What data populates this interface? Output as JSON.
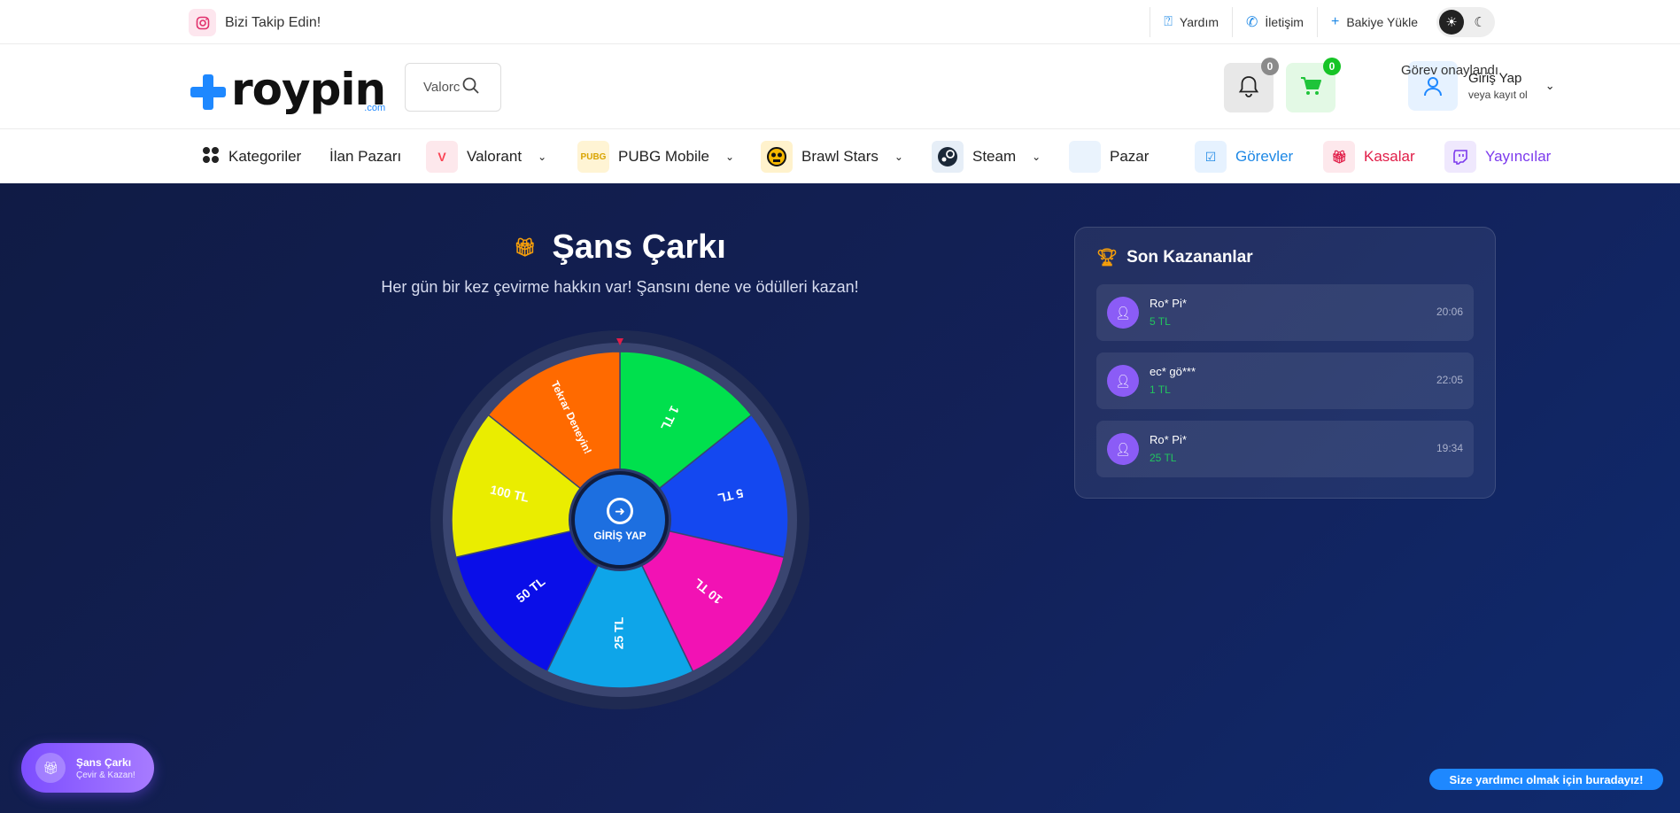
{
  "topbar": {
    "instagram_label": "Bizi Takip Edin!",
    "links": [
      {
        "label": "Yardım",
        "icon": "help-icon"
      },
      {
        "label": "İletişim",
        "icon": "phone-icon"
      },
      {
        "label": "Bakiye Yükle",
        "icon": "plus-icon"
      }
    ]
  },
  "header": {
    "logo_text": "roypin",
    "logo_suffix": ".com",
    "search_value": "Valorc",
    "notification_count": "0",
    "cart_count": "0",
    "login_title": "Giriş Yap",
    "login_sub": "veya kayıt ol",
    "toast": "Görev onaylandı."
  },
  "nav": {
    "categories": "Kategoriler",
    "market": "İlan Pazarı",
    "valorant": "Valorant",
    "pubg": "PUBG Mobile",
    "brawl": "Brawl Stars",
    "steam": "Steam",
    "pazar": "Pazar",
    "tasks": "Görevler",
    "cases": "Kasalar",
    "streamers": "Yayıncılar"
  },
  "wheel": {
    "title": "Şans Çarkı",
    "subtitle": "Her gün bir kez çevirme hakkın var! Şansını dene ve ödülleri kazan!",
    "spin_label": "GİRİŞ YAP",
    "segments": [
      {
        "label": "1 TL",
        "color": "#00e04d"
      },
      {
        "label": "5 TL",
        "color": "#1448f0"
      },
      {
        "label": "10 TL",
        "color": "#f212b4"
      },
      {
        "label": "25 TL",
        "color": "#0ea5e9"
      },
      {
        "label": "50 TL",
        "color": "#0a0ee8"
      },
      {
        "label": "100 TL",
        "color": "#eaed00"
      },
      {
        "label": "Tekrar Deneyin!",
        "color": "#ff6a00"
      }
    ]
  },
  "winners": {
    "title": "Son Kazananlar",
    "rows": [
      {
        "name": "Ro* Pi*",
        "amount": "5 TL",
        "time": "20:06"
      },
      {
        "name": "ec* gö***",
        "amount": "1 TL",
        "time": "22:05"
      },
      {
        "name": "Ro* Pi*",
        "amount": "25 TL",
        "time": "19:34"
      }
    ]
  },
  "float": {
    "title": "Şans Çarkı",
    "sub": "Çevir & Kazan!"
  },
  "help": "Size yardımcı olmak için buradayız!",
  "colors": {
    "accent": "#1e88ff",
    "bg": "#121d4c",
    "tasks": "#1e88e5",
    "cases": "#e11d48",
    "streamers": "#7c3aed"
  }
}
